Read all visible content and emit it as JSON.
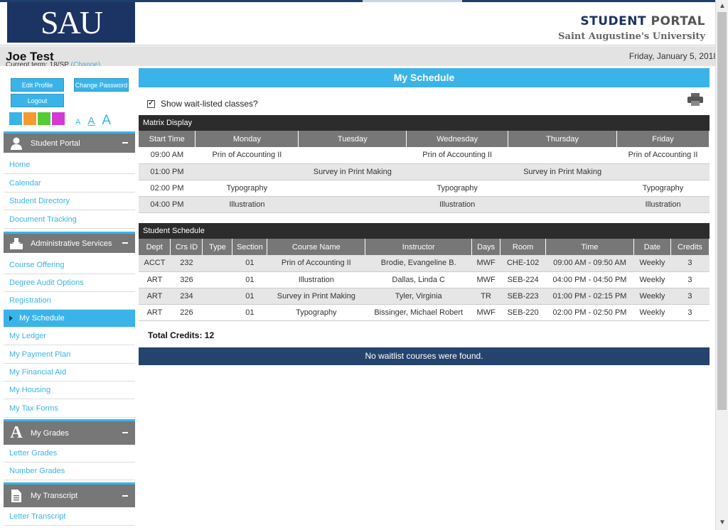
{
  "header": {
    "logo_text": "SAU",
    "portal_title_1": "STUDENT",
    "portal_title_2": "PORTAL",
    "university": "Saint Augustine's University"
  },
  "user": {
    "name": "Joe Test",
    "term_label": "Current term: 18/SP",
    "change_label": "(Change)",
    "date": "Friday, January 5, 2018"
  },
  "sidebar": {
    "edit_profile": "Edit Profile",
    "change_password": "Change Password",
    "logout": "Logout",
    "swatch_colors": [
      "#3ab4e8",
      "#f59b2e",
      "#55cc33",
      "#d43ad4"
    ],
    "font_small": "A",
    "font_medium": "A",
    "font_large": "A",
    "sections": [
      {
        "title": "Student Portal",
        "icon": "user-icon",
        "items": [
          "Home",
          "Calendar",
          "Student Directory",
          "Document Tracking"
        ]
      },
      {
        "title": "Administrative Services",
        "icon": "inbox-icon",
        "items": [
          "Course Offering",
          "Degree Audit Options",
          "Registration",
          "My Schedule",
          "My Ledger",
          "My Payment Plan",
          "My Financial Aid",
          "My Housing",
          "My Tax Forms"
        ]
      },
      {
        "title": "My Grades",
        "icon": "letter-a-icon",
        "items": [
          "Letter Grades",
          "Number Grades"
        ]
      },
      {
        "title": "My Transcript",
        "icon": "document-icon",
        "items": [
          "Letter Transcript"
        ]
      }
    ],
    "active_item": "My Schedule"
  },
  "main": {
    "banner": "My Schedule",
    "waitlist_label": "Show wait-listed classes?",
    "matrix_title": "Matrix Display",
    "matrix_headers": [
      "Start Time",
      "Monday",
      "Tuesday",
      "Wednesday",
      "Thursday",
      "Friday"
    ],
    "matrix_rows": [
      [
        "09:00 AM",
        "Prin of Accounting II",
        "",
        "Prin of Accounting II",
        "",
        "Prin of Accounting II"
      ],
      [
        "01:00 PM",
        "",
        "Survey in Print Making",
        "",
        "Survey in Print Making",
        ""
      ],
      [
        "02:00 PM",
        "Typography",
        "",
        "Typography",
        "",
        "Typography"
      ],
      [
        "04:00 PM",
        "Illustration",
        "",
        "Illustration",
        "",
        "Illustration"
      ]
    ],
    "schedule_title": "Student Schedule",
    "schedule_headers": [
      "Dept",
      "Crs ID",
      "Type",
      "Section",
      "Course Name",
      "Instructor",
      "Days",
      "Room",
      "Time",
      "Date",
      "Credits"
    ],
    "schedule_rows": [
      [
        "ACCT",
        "232",
        "",
        "01",
        "Prin of Accounting II",
        "Brodie, Evangeline B.",
        "MWF",
        "CHE-102",
        "09:00 AM - 09:50 AM",
        "Weekly",
        "3"
      ],
      [
        "ART",
        "326",
        "",
        "01",
        "Illustration",
        "Dallas, Linda C",
        "MWF",
        "SEB-224",
        "04:00 PM - 04:50 PM",
        "Weekly",
        "3"
      ],
      [
        "ART",
        "234",
        "",
        "01",
        "Survey in Print Making",
        "Tyler, Virginia",
        "TR",
        "SEB-223",
        "01:00 PM - 02:15 PM",
        "Weekly",
        "3"
      ],
      [
        "ART",
        "226",
        "",
        "01",
        "Typography",
        "Bissinger, Michael Robert",
        "MWF",
        "SEB-220",
        "02:00 PM - 02:50 PM",
        "Weekly",
        "3"
      ]
    ],
    "total_credits": "Total Credits: 12",
    "no_waitlist": "No waitlist courses were found."
  }
}
